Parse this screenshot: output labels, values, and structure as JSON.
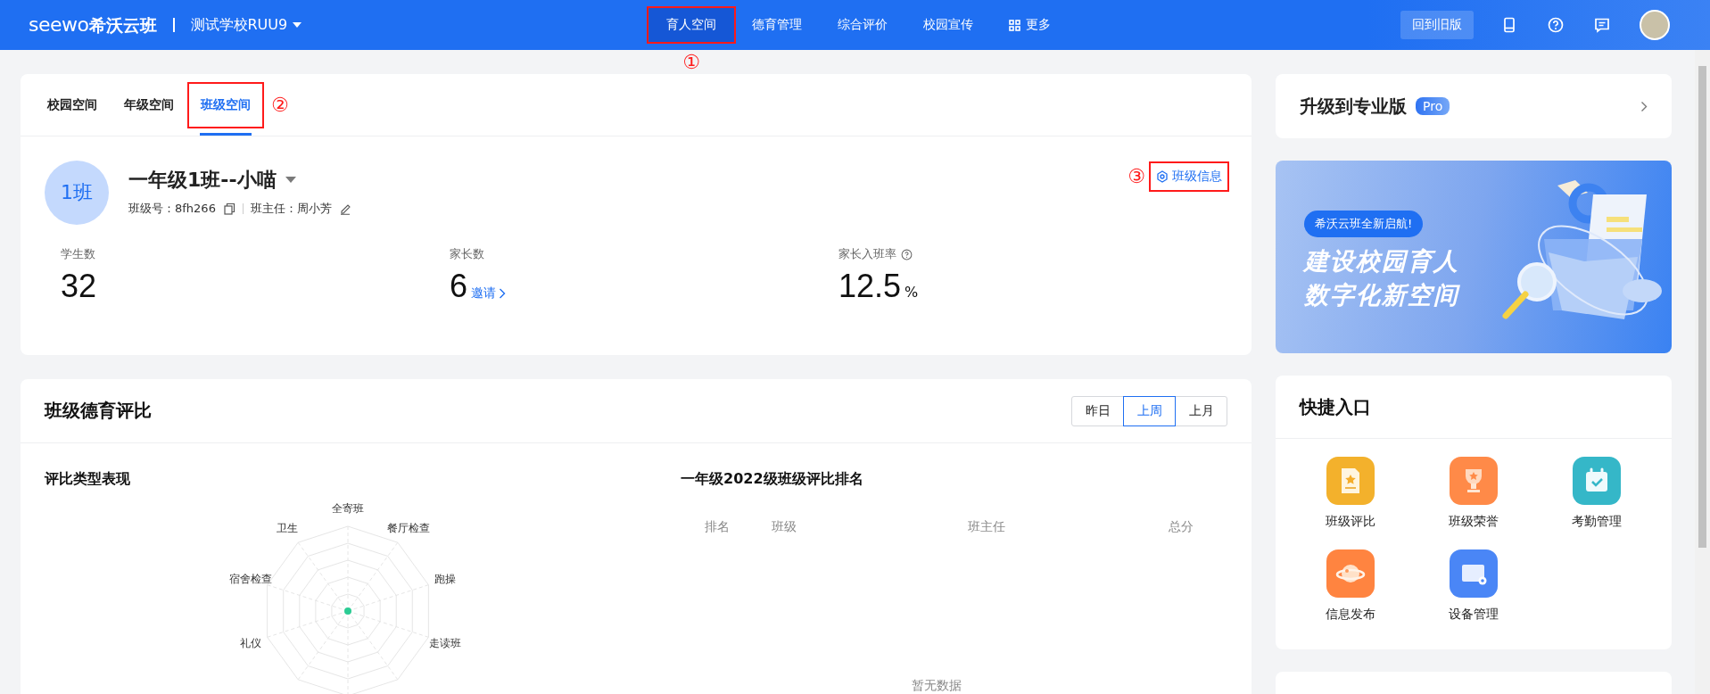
{
  "header": {
    "logo": {
      "mark": "seewo",
      "name": "希沃云班"
    },
    "school": "测试学校RUU9",
    "nav": [
      {
        "label": "育人空间",
        "selected": true,
        "marker": "①",
        "kind": "text"
      },
      {
        "label": "德育管理",
        "selected": false,
        "kind": "text"
      },
      {
        "label": "综合评价",
        "selected": false,
        "kind": "text"
      },
      {
        "label": "校园宣传",
        "selected": false,
        "kind": "text"
      },
      {
        "label": "更多",
        "selected": false,
        "kind": "grid"
      }
    ],
    "old_version_button": "回到旧版"
  },
  "space_tabs": [
    {
      "label": "校园空间",
      "selected": false
    },
    {
      "label": "年级空间",
      "selected": false
    },
    {
      "label": "班级空间",
      "selected": true,
      "marker": "②"
    }
  ],
  "class_info": {
    "avatar": "1班",
    "name": "一年级1班--小喵",
    "code": "班级号：8fh266",
    "teacher": "班主任：周小芳",
    "settings_link": "班级信息",
    "settings_marker": "③",
    "stats": [
      {
        "label": "学生数",
        "value": "32"
      },
      {
        "label": "家长数",
        "value": "6",
        "link": "邀请"
      },
      {
        "label": "家长入班率",
        "value": "12.5",
        "unit": "%",
        "help": true
      }
    ]
  },
  "moral": {
    "title": "班级德育评比",
    "periods": [
      {
        "label": "昨日",
        "selected": false
      },
      {
        "label": "上周",
        "selected": true
      },
      {
        "label": "上月",
        "selected": false
      }
    ],
    "radar": {
      "title": "评比类型表现",
      "labels": [
        "全寄班",
        "餐厅检查",
        "跑操",
        "走读班",
        "礼仪",
        "宿舍检查",
        "卫生"
      ]
    },
    "ranking": {
      "title": "一年级2022级班级评比排名",
      "columns": [
        "排名",
        "班级",
        "班主任",
        "总分"
      ],
      "empty": "暂无数据"
    }
  },
  "upgrade": {
    "title": "升级到专业版",
    "badge": "Pro"
  },
  "banner": {
    "pill": "希沃云班全新启航!",
    "lines": [
      "建设校园育人",
      "数字化新空间"
    ]
  },
  "shortcuts": {
    "title": "快捷入口",
    "items": [
      {
        "label": "班级评比",
        "kind": "document"
      },
      {
        "label": "班级荣誉",
        "kind": "trophy"
      },
      {
        "label": "考勤管理",
        "kind": "calendar"
      },
      {
        "label": "信息发布",
        "kind": "planet"
      },
      {
        "label": "设备管理",
        "kind": "device"
      }
    ]
  }
}
